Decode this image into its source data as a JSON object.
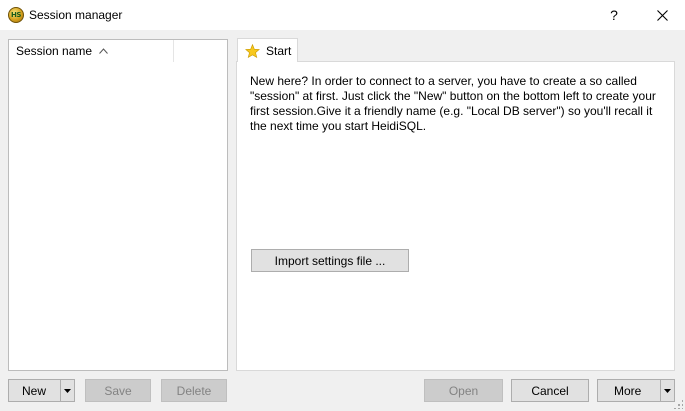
{
  "window": {
    "title": "Session manager",
    "icon_label": "HS",
    "help_label": "?",
    "close_label": "✕"
  },
  "session_list": {
    "column_header": "Session name",
    "sort_indicator": "^"
  },
  "tabs": [
    {
      "label": "Start",
      "icon": "star-icon"
    }
  ],
  "start_panel": {
    "intro_text": "New here? In order to connect to a server, you have to create a so called \"session\" at first. Just click the \"New\" button on the bottom left to create your first session.Give it a friendly name (e.g. \"Local DB server\") so you'll recall it the next time you start HeidiSQL.",
    "import_button": "Import settings file ..."
  },
  "buttons": {
    "new": "New",
    "save": "Save",
    "delete": "Delete",
    "open": "Open",
    "cancel": "Cancel",
    "more": "More",
    "dropdown_arrow": "▼"
  },
  "colors": {
    "window_bg": "#f0f0f0",
    "panel_bg": "#ffffff",
    "button_bg": "#e1e1e1",
    "disabled_text": "#838383",
    "star": "#f1c40f"
  }
}
